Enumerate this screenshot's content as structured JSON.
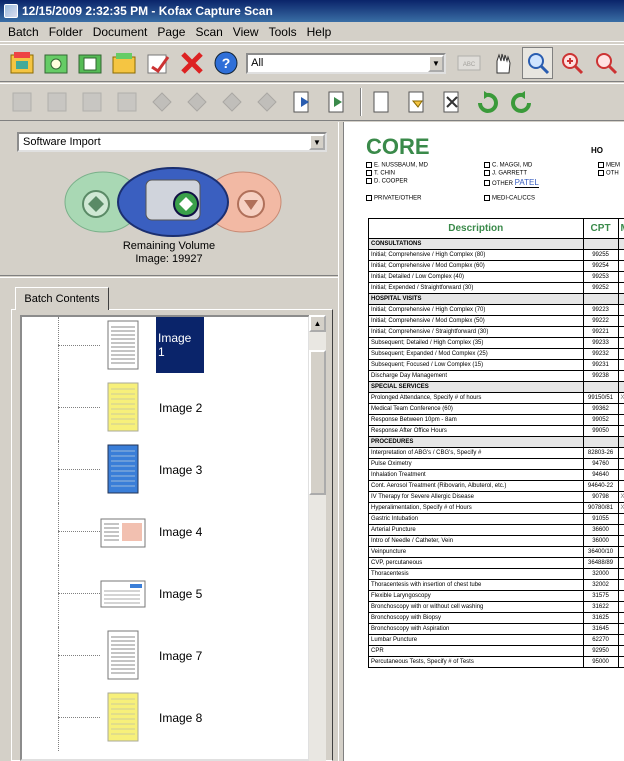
{
  "window": {
    "title": "12/15/2009 2:32:35 PM - Kofax Capture Scan"
  },
  "menu": [
    "Batch",
    "Folder",
    "Document",
    "Page",
    "Scan",
    "View",
    "Tools",
    "Help"
  ],
  "toolbar": {
    "filter_value": "All"
  },
  "left": {
    "source_value": "Software Import",
    "remaining_label": "Remaining Volume",
    "remaining_value": "Image: 19927",
    "tab_label": "Batch Contents"
  },
  "tree_items": [
    {
      "label": "Image 1",
      "kind": "white",
      "selected": true
    },
    {
      "label": "Image 2",
      "kind": "yellow",
      "selected": false
    },
    {
      "label": "Image 3",
      "kind": "blue",
      "selected": false
    },
    {
      "label": "Image 4",
      "kind": "land-red",
      "selected": false
    },
    {
      "label": "Image 5",
      "kind": "land-white",
      "selected": false
    },
    {
      "label": "Image 7",
      "kind": "white",
      "selected": false
    },
    {
      "label": "Image 8",
      "kind": "yellow",
      "selected": false
    }
  ],
  "document": {
    "title": "CORE",
    "ho": "HO",
    "doctors": [
      "E. NUSSBAUM, MD",
      "C. MAGGI, MD",
      "MEM",
      "T. CHIN",
      "J. GARRETT",
      "OTH",
      "D. COOPER",
      "OTHER",
      "PATEL",
      "PRIVATE/OTHER",
      "MEDI-CAL/CCS"
    ],
    "col_description": "Description",
    "col_cpt": "CPT",
    "col_mo": "Mo",
    "rows": [
      {
        "d": "CONSULTATIONS",
        "c": "",
        "sec": true
      },
      {
        "d": "Initial; Comprehensive / High Complex (80)",
        "c": "99255"
      },
      {
        "d": "Initial; Comprehensive / Mod Complex (60)",
        "c": "99254"
      },
      {
        "d": "Initial; Detailed / Low Complex (40)",
        "c": "99253"
      },
      {
        "d": "Initial; Expended / Straightforward (30)",
        "c": "99252"
      },
      {
        "d": "HOSPITAL VISITS",
        "c": "",
        "sec": true
      },
      {
        "d": "Initial; Comprehensive / High Complex (70)",
        "c": "99223"
      },
      {
        "d": "Initial; Comprehensive / Mod Complex (50)",
        "c": "99222"
      },
      {
        "d": "Initial; Comprehensive / Straightforward (30)",
        "c": "99221"
      },
      {
        "d": "Subsequent; Detailed / High Complex (35)",
        "c": "99233"
      },
      {
        "d": "Subsequent; Expanded / Mod Complex (25)",
        "c": "99232"
      },
      {
        "d": "Subsequent; Focused / Low Complex (15)",
        "c": "99231"
      },
      {
        "d": "Discharge Day Management",
        "c": "99238"
      },
      {
        "d": "SPECIAL SERVICES",
        "c": "",
        "sec": true
      },
      {
        "d": "Prolonged Attendance, Specify # of hours",
        "c": "99150/51",
        "m": "X"
      },
      {
        "d": "Medical Team Conference (60)",
        "c": "99362"
      },
      {
        "d": "Response Between 10pm - 8am",
        "c": "99052"
      },
      {
        "d": "Response After Office Hours",
        "c": "99050"
      },
      {
        "d": "PROCEDURES",
        "c": "",
        "sec": true
      },
      {
        "d": "Interpretation of ABG's / CBG's, Specify #",
        "c": "82803-26"
      },
      {
        "d": "Pulse Oximetry",
        "c": "94760"
      },
      {
        "d": "Inhalation Treatment",
        "c": "94640"
      },
      {
        "d": "Cont. Aerosol Treatment (Ribovarin, Albuterol, etc.)",
        "c": "94640-22"
      },
      {
        "d": "IV Therapy for Severe Allergic Disease",
        "c": "90798",
        "m": "X"
      },
      {
        "d": "Hyperalimentation, Specify # of Hours",
        "c": "90780/81",
        "m": "X"
      },
      {
        "d": "Gastric Intubation",
        "c": "91055"
      },
      {
        "d": "Arterial Puncture",
        "c": "36600"
      },
      {
        "d": "Intro of Needle / Catheter, Vein",
        "c": "36000"
      },
      {
        "d": "Veinpuncture",
        "c": "36400/10"
      },
      {
        "d": "CVP, percutaneous",
        "c": "36488/89"
      },
      {
        "d": "Thoracentesis",
        "c": "32000"
      },
      {
        "d": "Thoracentesis with insertion of chest tube",
        "c": "32002"
      },
      {
        "d": "Flexible Laryngoscopy",
        "c": "31575"
      },
      {
        "d": "Bronchoscopy with or without cell washing",
        "c": "31622"
      },
      {
        "d": "Bronchoscopy with Biopsy",
        "c": "31625"
      },
      {
        "d": "Bronchoscopy with Aspiration",
        "c": "31645"
      },
      {
        "d": "Lumbar Puncture",
        "c": "62270"
      },
      {
        "d": "CPR",
        "c": "92950"
      },
      {
        "d": "Percutaneous Tests, Specify # of Tests",
        "c": "95000"
      }
    ]
  }
}
